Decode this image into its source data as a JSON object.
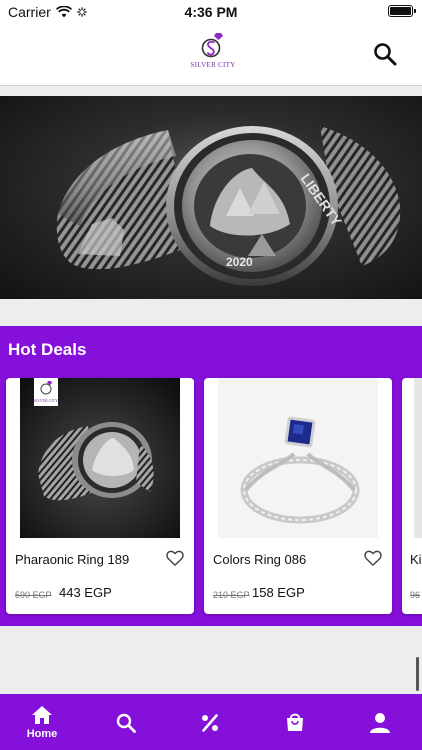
{
  "status_bar": {
    "carrier": "Carrier",
    "time": "4:36 PM"
  },
  "header": {
    "brand": "SILVER CITY",
    "logo_icon": "ring-logo-icon",
    "search_icon": "search-icon"
  },
  "hero": {
    "image": "silver-pharaonic-ring-banner",
    "ring_text_top": "LIBERTY",
    "ring_text_bottom": "2020"
  },
  "hot_deals": {
    "title": "Hot Deals",
    "products": [
      {
        "name": "Pharaonic Ring 189",
        "old_price": "590 EGP",
        "price": "443 EGP",
        "image": "pharaonic-ring-image",
        "badge": "SILVER CITY"
      },
      {
        "name": "Colors Ring 086",
        "old_price": "210 EGP",
        "price": "158 EGP",
        "image": "blue-stone-ring-image"
      },
      {
        "name": "Ki",
        "old_price": "96",
        "price": ""
      }
    ]
  },
  "tab_bar": {
    "tabs": [
      {
        "label": "Home",
        "icon": "home-icon",
        "active": true
      },
      {
        "label": "",
        "icon": "search-icon"
      },
      {
        "label": "",
        "icon": "percent-icon"
      },
      {
        "label": "",
        "icon": "shopping-bag-icon"
      },
      {
        "label": "",
        "icon": "user-icon"
      }
    ]
  },
  "colors": {
    "accent": "#8410d9",
    "background": "#ededed",
    "card": "#ffffff"
  }
}
